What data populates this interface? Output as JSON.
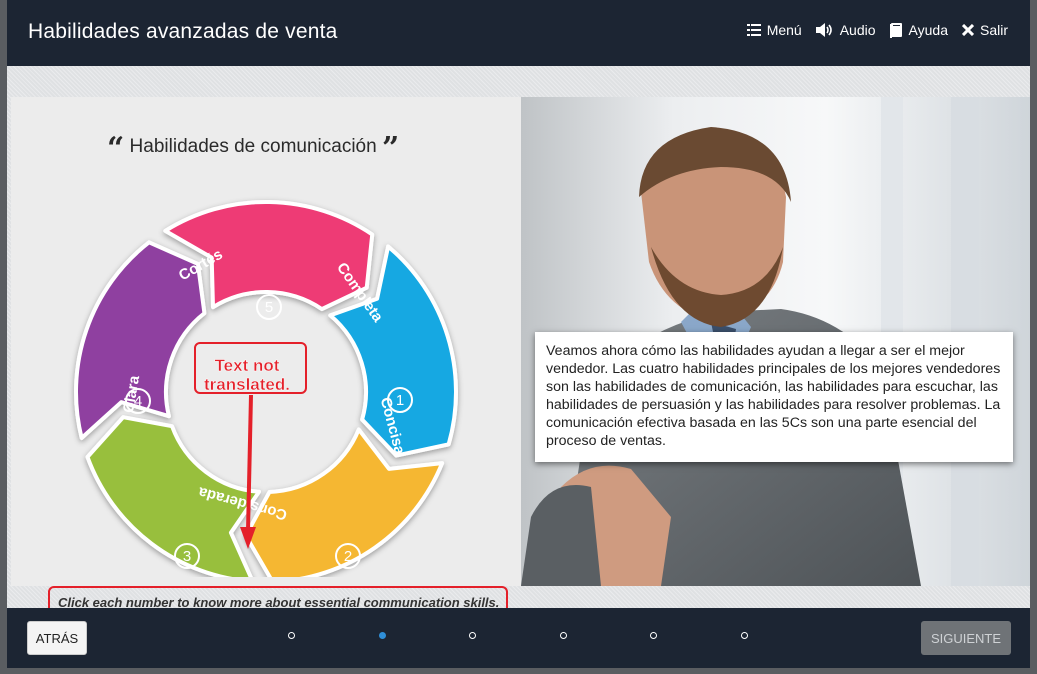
{
  "header": {
    "title": "Habilidades avanzadas de venta",
    "nav": [
      {
        "label": "Menú",
        "icon": "list-icon"
      },
      {
        "label": "Audio",
        "icon": "speaker-icon"
      },
      {
        "label": "Ayuda",
        "icon": "book-icon"
      },
      {
        "label": "Salir",
        "icon": "close-icon"
      }
    ]
  },
  "slide": {
    "heading": "Habilidades de comunicación",
    "open_quote": "“",
    "close_quote": "”",
    "segments": [
      {
        "label": "Completa",
        "number": "1",
        "color": "#ee3a74"
      },
      {
        "label": "Concisa",
        "number": "2",
        "color": "#13a8e2"
      },
      {
        "label": "Considerada",
        "number": "3",
        "color": "#f5b731"
      },
      {
        "label": "Clara",
        "number": "4",
        "color": "#98bf3d"
      },
      {
        "label": "Cortés",
        "number": "5",
        "color": "#8f3fa0"
      }
    ],
    "annotation": "Text not translated.",
    "annotation_lines": [
      "Text not",
      "translated."
    ],
    "instruction": "Click each number to know more about essential communication skills.",
    "body_text": "Veamos ahora cómo las habilidades ayudan a llegar a ser el mejor vendedor. Las cuatro habilidades principales de los mejores vendedores son las habilidades de comunicación, las habilidades para escuchar, las habilidades de persuasión y las habilidades para resolver problemas. La comunicación efectiva basada en las 5Cs son una parte esencial del proceso de ventas."
  },
  "footer": {
    "back_label": "ATRÁS",
    "next_label": "SIGUIENTE",
    "pages": 6,
    "current_page": 2
  },
  "colors": {
    "bar": "#1c2533",
    "active_dot": "#2f8fd8",
    "annotation": "#e4202a"
  }
}
